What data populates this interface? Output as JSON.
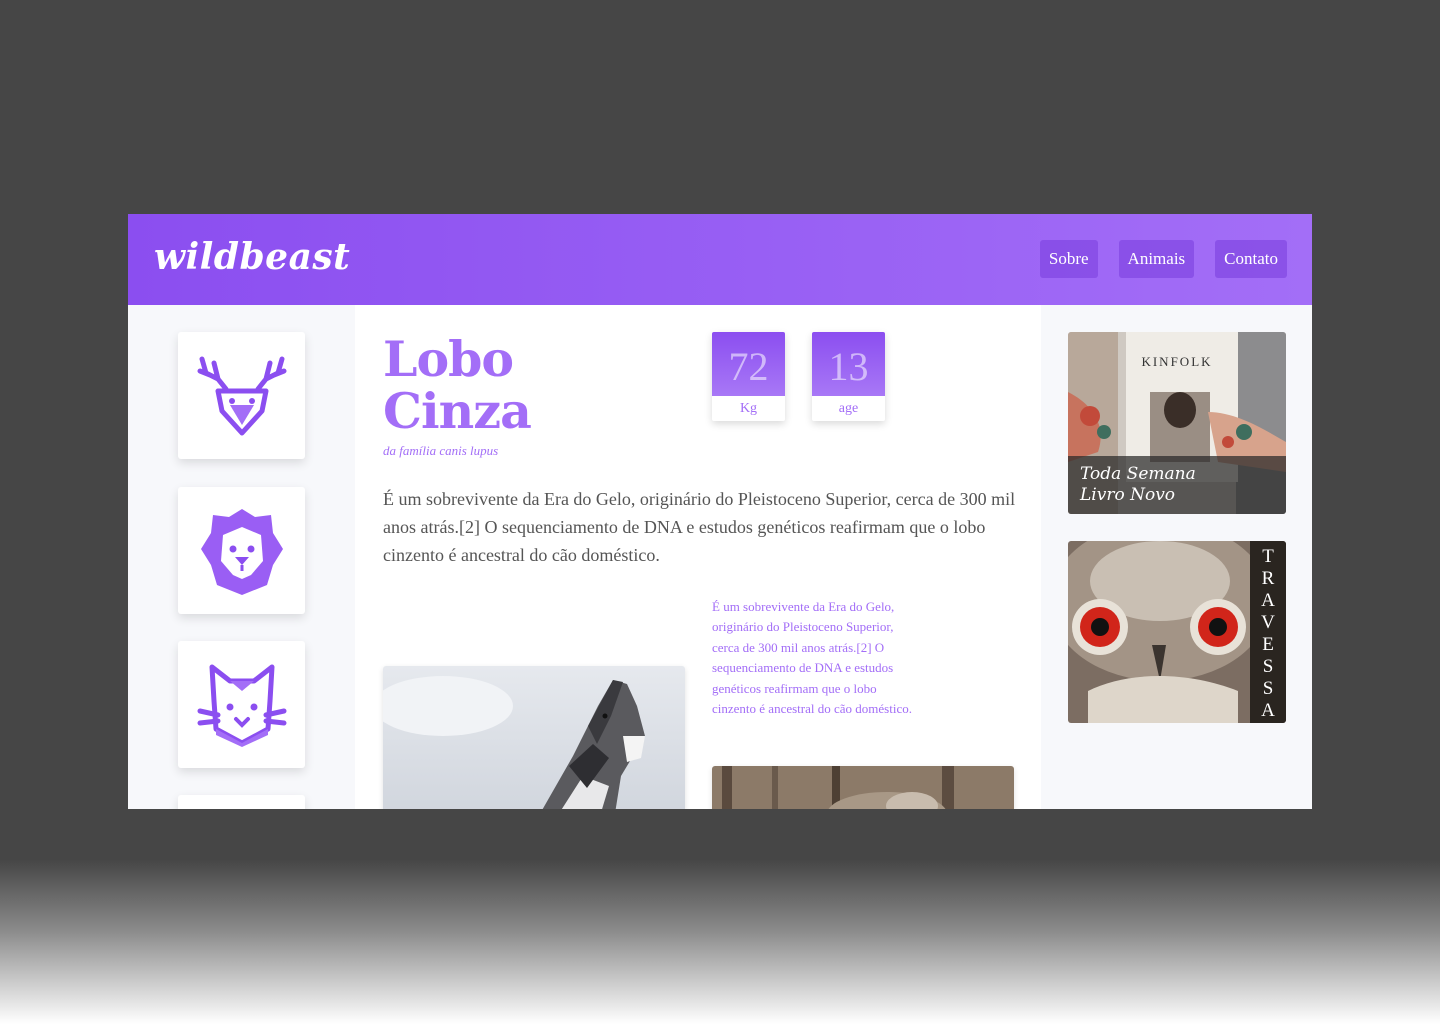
{
  "header": {
    "logo": "wildbeast",
    "nav": [
      "Sobre",
      "Animais",
      "Contato"
    ]
  },
  "sidebar": {
    "icons": [
      "deer-icon",
      "lion-icon",
      "cat-icon"
    ]
  },
  "animal": {
    "title_line1": "Lobo",
    "title_line2": "Cinza",
    "subtitle": "da família canis lupus",
    "stats": [
      {
        "value": "72",
        "label": "Kg"
      },
      {
        "value": "13",
        "label": "age"
      }
    ],
    "lead": "É um sobrevivente da Era do Gelo, originário do Pleistoceno Superior, cerca de 300 mil anos atrás.[2] O sequenciamento de DNA e estudos genéticos reafirmam que o lobo cinzento é ancestral do cão doméstico.",
    "side_text": "É um sobrevivente da Era do Gelo, originário do Pleistoceno Superior, cerca de 300 mil anos atrás.[2] O sequenciamento de DNA e estudos genéticos reafirmam que o lobo cinzento é ancestral do cão doméstico."
  },
  "ads": {
    "book": {
      "magazine": "KINFOLK",
      "caption_line1": "Toda Semana",
      "caption_line2": "Livro Novo"
    },
    "owl": {
      "vertical_label": [
        "T",
        "R",
        "A",
        "V",
        "E",
        "S",
        "S",
        "A"
      ]
    }
  },
  "colors": {
    "accent": "#a36ef7",
    "accent_dark": "#8b4ef0",
    "text": "#555555",
    "backdrop": "#464646"
  }
}
